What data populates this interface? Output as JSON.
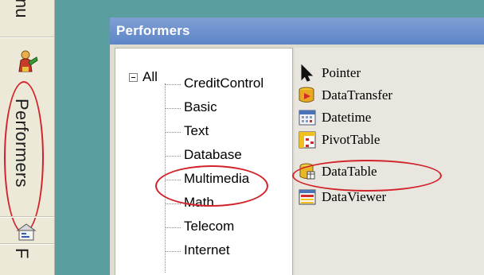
{
  "sidebar": {
    "prev_tab_label": "nu",
    "active_tab_label": "Performers",
    "next_tab_label": "F",
    "icons": [
      "performers-icon",
      "properties-icon"
    ]
  },
  "panel": {
    "title": "Performers",
    "tree": {
      "root_label": "All",
      "expander_symbol": "−",
      "children": [
        "CreditControl",
        "Basic",
        "Text",
        "Database",
        "Multimedia",
        "Math",
        "Telecom",
        "Internet"
      ],
      "selected": "Database"
    },
    "palette": {
      "items": [
        {
          "label": "Pointer",
          "icon": "pointer-icon"
        },
        {
          "label": "DataTransfer",
          "icon": "data-transfer-icon"
        },
        {
          "label": "Datetime",
          "icon": "datetime-icon"
        },
        {
          "label": "PivotTable",
          "icon": "pivot-table-icon"
        },
        {
          "label": "DataTable",
          "icon": "data-table-icon"
        },
        {
          "label": "DataViewer",
          "icon": "data-viewer-icon"
        }
      ],
      "highlighted": "DataTable"
    }
  },
  "colors": {
    "background": "#5a9ea0",
    "titlebar": "#6c8fcc",
    "annotation": "#d2232a"
  }
}
